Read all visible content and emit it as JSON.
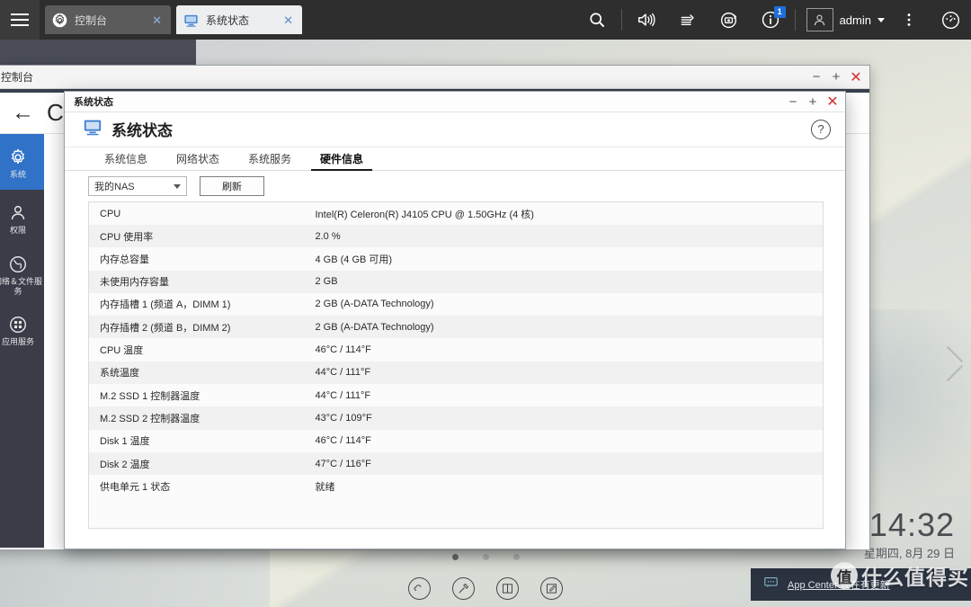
{
  "taskbar": {
    "menu_icon": "hamburger-icon",
    "tabs": [
      {
        "label": "控制台",
        "icon": "gear-icon",
        "active": false,
        "close": "✕"
      },
      {
        "label": "系统状态",
        "icon": "monitor-icon",
        "active": true,
        "close": "✕"
      }
    ],
    "icons": [
      {
        "name": "search-icon"
      },
      {
        "name": "volume-icon"
      },
      {
        "name": "backup-icon"
      },
      {
        "name": "sync-icon"
      },
      {
        "name": "info-icon",
        "badge": "1"
      }
    ],
    "user": {
      "avatar": "user-avatar-icon",
      "name": "admin",
      "caret": "▾"
    },
    "more_icon": "kebab-menu-icon",
    "dashboard_icon": "dashboard-gauge-icon"
  },
  "control_panel_window": {
    "titlebar_text": "控制台",
    "minimize": "−",
    "maximize": "+",
    "close": "✕",
    "back_arrow": "←",
    "title": "Control Panel",
    "sidebar": [
      {
        "label": "系统",
        "icon": "gear-icon",
        "active": true
      },
      {
        "label": "权限",
        "icon": "user-icon",
        "active": false
      },
      {
        "label": "网络＆文件服务",
        "icon": "globe-icon",
        "active": false
      },
      {
        "label": "应用服务",
        "icon": "grid-apps-icon",
        "active": false
      }
    ]
  },
  "system_status_window": {
    "titlebar_text": "系统状态",
    "minimize": "−",
    "maximize": "+",
    "close": "✕",
    "header_title": "系统状态",
    "header_icon": "monitor-icon",
    "help_icon": "question-mark-icon",
    "tabs": [
      {
        "label": "系统信息",
        "active": false
      },
      {
        "label": "网络状态",
        "active": false
      },
      {
        "label": "系统服务",
        "active": false
      },
      {
        "label": "硬件信息",
        "active": true
      }
    ],
    "toolbar": {
      "select_value": "我的NAS",
      "select_caret": "▾",
      "refresh_label": "刷新"
    },
    "table": {
      "rows": [
        {
          "key": "CPU",
          "value": "Intel(R) Celeron(R) J4105 CPU @ 1.50GHz (4 核)"
        },
        {
          "key": "CPU 使用率",
          "value": "2.0 %"
        },
        {
          "key": "内存总容量",
          "value": "4 GB (4 GB 可用)"
        },
        {
          "key": "未使用内存容量",
          "value": "2 GB"
        },
        {
          "key": "内存插槽 1 (频道 A，DIMM 1)",
          "value": "2 GB (A-DATA Technology)"
        },
        {
          "key": "内存插槽 2 (频道 B，DIMM 2)",
          "value": "2 GB (A-DATA Technology)"
        },
        {
          "key": "CPU 温度",
          "value": "46°C / 114°F"
        },
        {
          "key": "系统温度",
          "value": "44°C / 111°F"
        },
        {
          "key": "M.2 SSD 1 控制器温度",
          "value": "44°C / 111°F"
        },
        {
          "key": "M.2 SSD 2 控制器温度",
          "value": "43°C / 109°F"
        },
        {
          "key": "Disk 1 温度",
          "value": "46°C / 114°F"
        },
        {
          "key": "Disk 2 温度",
          "value": "47°C / 116°F"
        },
        {
          "key": "供电单元 1 状态",
          "value": "就绪"
        }
      ]
    }
  },
  "desktop": {
    "trash_icon": "trash-can-icon",
    "next_page_arrow": "chevron-right-icon",
    "pager": [
      {
        "active": true
      },
      {
        "active": false
      },
      {
        "active": false
      }
    ],
    "dock": [
      {
        "name": "cloud-icon"
      },
      {
        "name": "hammer-tools-icon"
      },
      {
        "name": "book-icon"
      },
      {
        "name": "notes-edit-icon"
      }
    ]
  },
  "clock": {
    "time": "14:32",
    "date": "星期四, 8月 29 日"
  },
  "toast": {
    "icon": "chat-bubble-icon",
    "message": "App Center 现在有更新"
  },
  "watermark": {
    "logo_char": "值",
    "text": "什么值得买"
  },
  "colors": {
    "taskbar_bg": "#2e2e2e",
    "accent_blue": "#2f72c8",
    "badge_blue": "#1e6fd9",
    "close_red": "#d1322d",
    "sidebar_bg": "#3a3d47",
    "toast_bg": "#2b3240"
  }
}
